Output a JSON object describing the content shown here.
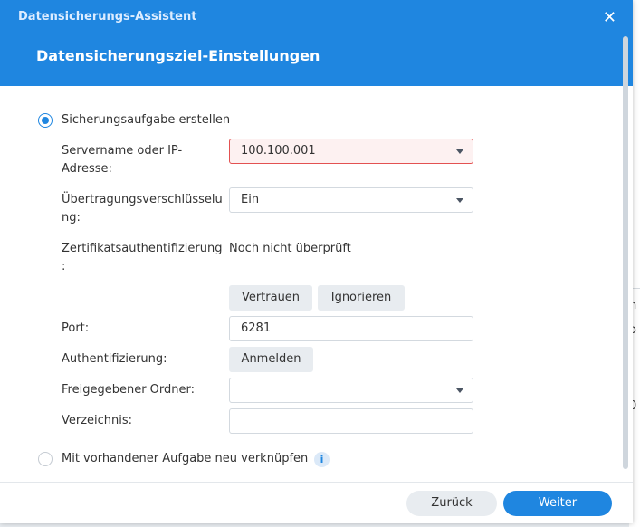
{
  "window": {
    "app_title": "Datensicherungs-Assistent",
    "step_title": "Datensicherungsziel-Einstellungen"
  },
  "options": {
    "create_task_label": "Sicherungsaufgabe erstellen",
    "relink_task_label": "Mit vorhandener Aufgabe neu verknüpfen",
    "selected": "create_task"
  },
  "form": {
    "server_label_line1": "Servername oder IP-",
    "server_label_line2": "Adresse:",
    "server_value": "100.100.001",
    "encryption_label_line1": "Übertragungsverschlüsselu",
    "encryption_label_line2": "ng:",
    "encryption_value": "Ein",
    "cert_label_line1": "Zertifikatsauthentifizierung",
    "cert_label_line2": ":",
    "cert_status": "Noch nicht überprüft",
    "trust_button": "Vertrauen",
    "ignore_button": "Ignorieren",
    "port_label": "Port:",
    "port_value": "6281",
    "auth_label": "Authentifizierung:",
    "login_button": "Anmelden",
    "shared_folder_label": "Freigegebener Ordner:",
    "shared_folder_value": "",
    "directory_label": "Verzeichnis:",
    "directory_value": ""
  },
  "footer": {
    "back_label": "Zurück",
    "next_label": "Weiter"
  },
  "background": {
    "peek_1": "n",
    "peek_2": "o",
    "peek_3": "0"
  },
  "colors": {
    "accent": "#1f86e0",
    "error_border": "#e35151"
  }
}
